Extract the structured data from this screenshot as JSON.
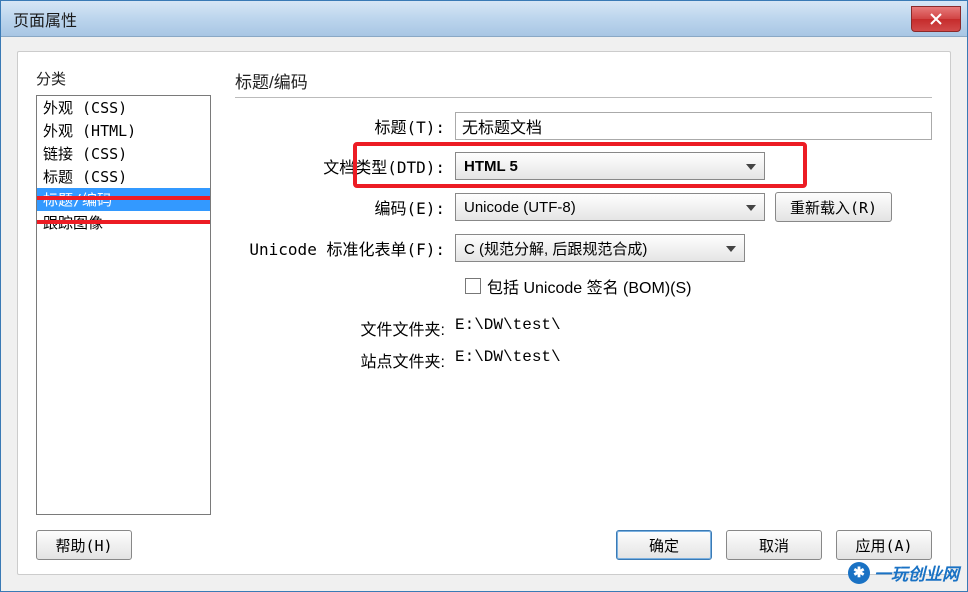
{
  "window": {
    "title": "页面属性"
  },
  "category": {
    "label": "分类",
    "items": [
      "外观 (CSS)",
      "外观 (HTML)",
      "链接 (CSS)",
      "标题 (CSS)",
      "标题/编码",
      "跟踪图像"
    ],
    "selected_index": 4
  },
  "panel": {
    "heading": "标题/编码",
    "title_label": "标题(T):",
    "title_value": "无标题文档",
    "dtd_label": "文档类型(DTD):",
    "dtd_value": "HTML 5",
    "encoding_label": "编码(E):",
    "encoding_value": "Unicode (UTF-8)",
    "reload_label": "重新载入(R)",
    "norm_label": "Unicode 标准化表单(F):",
    "norm_value": "C (规范分解, 后跟规范合成)",
    "bom_label": "包括 Unicode 签名 (BOM)(S)",
    "file_folder_label": "文件文件夹:",
    "file_folder_value": "E:\\DW\\test\\",
    "site_folder_label": "站点文件夹:",
    "site_folder_value": "E:\\DW\\test\\"
  },
  "buttons": {
    "help": "帮助(H)",
    "ok": "确定",
    "cancel": "取消",
    "apply": "应用(A)"
  },
  "watermark": "一玩创业网"
}
